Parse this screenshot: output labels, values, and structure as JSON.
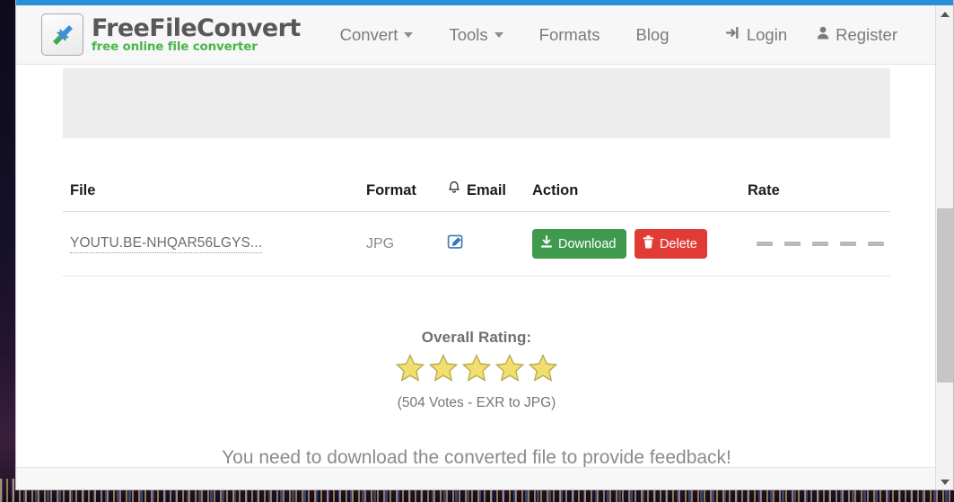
{
  "browser": {
    "accent_color": "#2b8fd8",
    "scrollbar": {
      "up_arrow_icon": "scroll-up-arrow-icon",
      "down_arrow_icon": "scroll-down-arrow-icon"
    }
  },
  "header": {
    "logo_icon": "freefileconvert-logo-icon",
    "brand_name": "FreeFileConvert",
    "brand_tagline": "free online file converter",
    "brand_name_color": "#58585a",
    "brand_tagline_color": "#49b649",
    "nav": [
      {
        "label": "Convert",
        "has_caret": true
      },
      {
        "label": "Tools",
        "has_caret": true
      },
      {
        "label": "Formats",
        "has_caret": false
      },
      {
        "label": "Blog",
        "has_caret": false
      }
    ],
    "account": [
      {
        "label": "Login",
        "icon": "login-arrow-icon"
      },
      {
        "label": "Register",
        "icon": "user-person-icon"
      }
    ]
  },
  "table": {
    "columns": {
      "file": "File",
      "format": "Format",
      "email": "Email",
      "email_icon": "bell-icon",
      "action": "Action",
      "rate": "Rate"
    },
    "rows": [
      {
        "file": "YOUTU.BE-NHQAR56LGYS...",
        "format": "JPG",
        "email_icon": "edit-pencil-square-icon",
        "download_label": "Download",
        "download_icon": "download-icon",
        "download_color": "#3f9a4e",
        "delete_label": "Delete",
        "delete_icon": "trash-icon",
        "delete_color": "#e03b35",
        "rate_placeholder_count": 5
      }
    ]
  },
  "rating": {
    "label": "Overall Rating:",
    "stars_filled": 5,
    "star_color": "#f2de6e",
    "votes_line": "(504 Votes - EXR to JPG)"
  },
  "feedback_note": "You need to download the converted file to provide feedback!"
}
